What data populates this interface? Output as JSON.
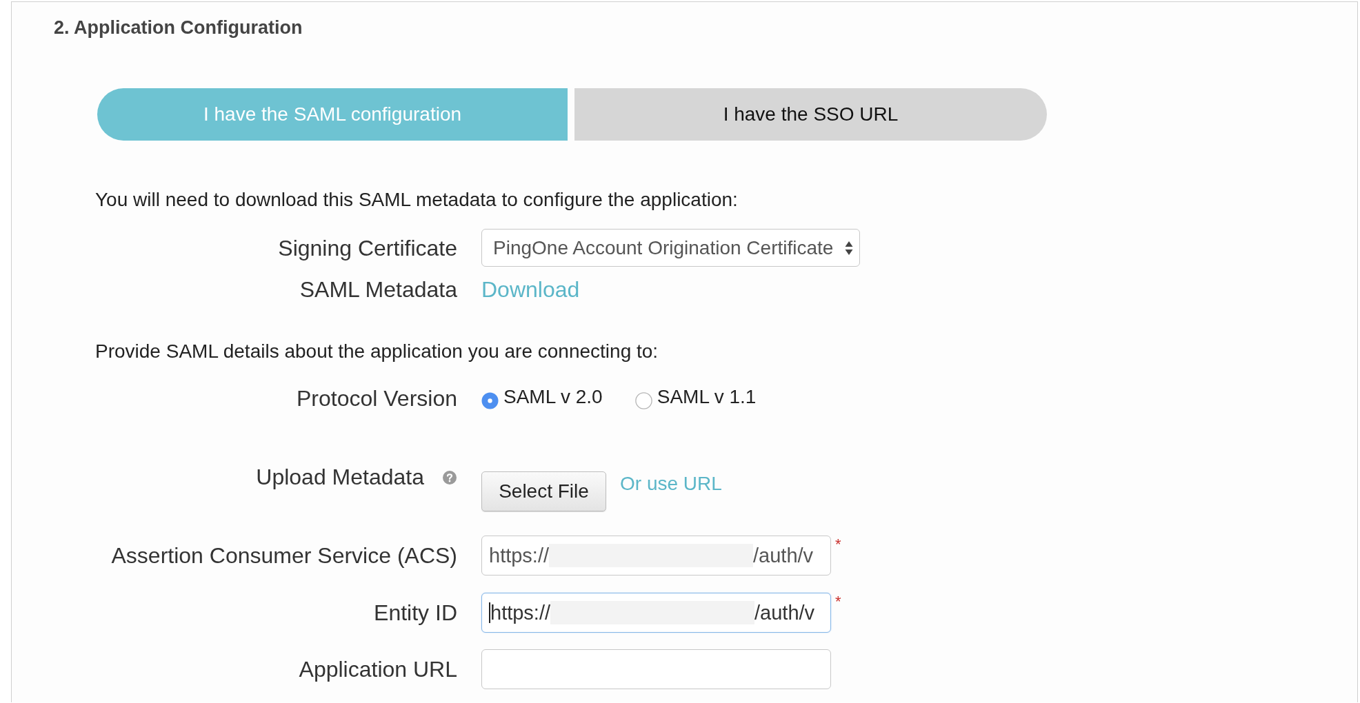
{
  "section": {
    "title": "2. Application Configuration"
  },
  "tabs": [
    {
      "label": "I have the SAML configuration",
      "selected": true
    },
    {
      "label": "I have the SSO URL",
      "selected": false
    }
  ],
  "metadata_download": {
    "intro": "You will need to download this SAML metadata to configure the application:",
    "signing_certificate": {
      "label": "Signing Certificate",
      "value": "PingOne Account Origination Certificate"
    },
    "saml_metadata": {
      "label": "SAML Metadata",
      "link": "Download"
    }
  },
  "application_details": {
    "intro": "Provide SAML details about the application you are connecting to:",
    "protocol_version": {
      "label": "Protocol Version",
      "options": [
        {
          "label": "SAML v 2.0",
          "selected": true
        },
        {
          "label": "SAML v 1.1",
          "selected": false
        }
      ]
    },
    "upload_metadata": {
      "label": "Upload Metadata",
      "button": "Select File",
      "link": "Or use URL"
    },
    "fields": [
      {
        "label": "Assertion Consumer Service (ACS)",
        "value_start": "https://",
        "value_end": "/auth/v",
        "redacted": true,
        "focused": false,
        "required_mark": "*"
      },
      {
        "label": "Entity ID",
        "value_start": "https://",
        "value_end": "/auth/v",
        "redacted": true,
        "focused": true,
        "required_mark": "*"
      },
      {
        "label": "Application URL",
        "redacted": false,
        "focused": false
      }
    ]
  }
}
